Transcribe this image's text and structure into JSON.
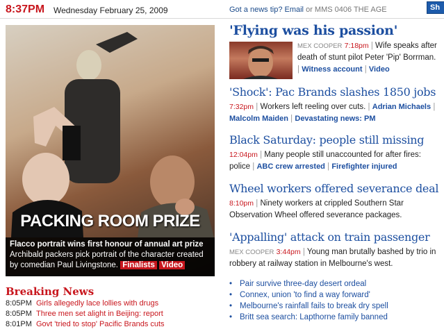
{
  "header": {
    "time": "8:37PM",
    "date": "Wednesday February 25, 2009",
    "tip_prefix": "Got a news tip?",
    "tip_email": "Email",
    "tip_suffix": "or MMS 0406 THE AGE",
    "search_button": "Sh"
  },
  "hero": {
    "headline": "PACKING ROOM PRIZE",
    "caption_title": "Flacco portrait wins first honour of annual art prize",
    "caption_text": "Archibald packers pick portrait of the character created by comedian Paul Livingstone.",
    "tag_finalists": "Finalists",
    "tag_video": "Video"
  },
  "breaking_news": {
    "title": "Breaking News",
    "items": [
      {
        "time": "8:05PM",
        "text": "Girls allegedly lace lollies with drugs"
      },
      {
        "time": "8:05PM",
        "text": "Three men set alight in Beijing: report"
      },
      {
        "time": "8:01PM",
        "text": "Govt 'tried to stop' Pacific Brands cuts"
      }
    ]
  },
  "stories": {
    "s1": {
      "headline": "'Flying was his passion'",
      "byline": "MEX COOPER",
      "time": "7:18pm",
      "text": "Wife speaks after death of stunt pilot Peter 'Pip' Borrman.",
      "links": [
        "Witness account",
        "Video"
      ]
    },
    "s2": {
      "headline": "'Shock': Pac Brands slashes 1850 jobs",
      "time": "7:32pm",
      "text": "Workers left reeling over cuts.",
      "links": [
        "Adrian Michaels",
        "Malcolm Maiden",
        "Devastating news: PM"
      ]
    },
    "s3": {
      "headline": "Black Saturday: people still missing",
      "time": "12:04pm",
      "text": "Many people still unaccounted for after fires: police",
      "links": [
        "ABC crew arrested",
        "Firefighter injured"
      ]
    },
    "s4": {
      "headline": "Wheel workers offered severance deal",
      "time": "8:10pm",
      "text": "Ninety workers at crippled Southern Star Observation Wheel offered severance packages."
    },
    "s5": {
      "headline": "'Appalling' attack on train passenger",
      "byline": "MEX COOPER",
      "time": "3:44pm",
      "text": "Young man brutally bashed by trio in robbery at railway station in Melbourne's west."
    }
  },
  "more_links": [
    "Pair survive three-day desert ordeal",
    "Connex, union 'to find a way forward'",
    "Melbourne's rainfall fails to break dry spell",
    "Britt sea search: Lapthorne family banned"
  ]
}
